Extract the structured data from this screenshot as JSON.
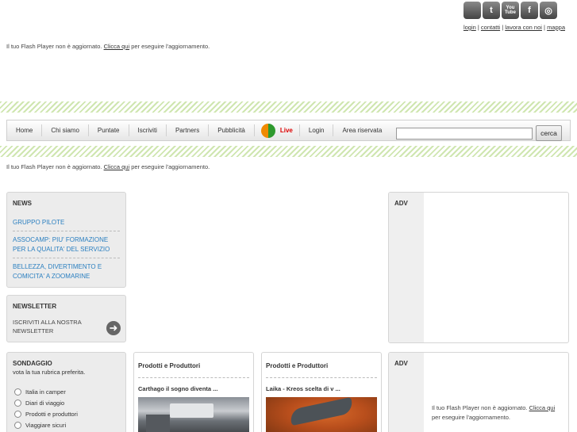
{
  "social": [
    {
      "icon": "apple-icon",
      "glyph": ""
    },
    {
      "icon": "twitter-icon",
      "glyph": "t"
    },
    {
      "icon": "youtube-icon",
      "glyph": "You Tube"
    },
    {
      "icon": "facebook-icon",
      "glyph": "f"
    },
    {
      "icon": "target-icon",
      "glyph": "◎"
    }
  ],
  "toplinks": {
    "login": "login",
    "contatti": "contatti",
    "lavora": "lavora con noi",
    "mappa": "mappa",
    "sep": " | "
  },
  "flash_msg": {
    "prefix": "Il tuo Flash Player non è aggiornato.",
    "link": "Clicca qui",
    "suffix": "per eseguire l'aggiornamento."
  },
  "flash_msg_split": {
    "line1": "Il tuo Flash Player non è aggiornato.",
    "link": "Clicca qui",
    "line2": "per eseguire l'aggiornamento."
  },
  "nav": {
    "items": [
      "Home",
      "Chi siamo",
      "Puntate",
      "Iscriviti",
      "Partners",
      "Pubblicità"
    ],
    "live": "Live",
    "login": "Login",
    "reserved": "Area riservata",
    "search_value": "",
    "search_button": "cerca"
  },
  "news": {
    "title": "NEWS",
    "items": [
      "GRUPPO PILOTE",
      "ASSOCAMP: PIU' FORMAZIONE PER LA QUALITA' DEL SERVIZIO",
      "BELLEZZA, DIVERTIMENTO E COMICITA' A ZOOMARINE"
    ]
  },
  "newsletter": {
    "title": "NEWSLETTER",
    "text": "ISCRIVITI ALLA NOSTRA NEWSLETTER"
  },
  "poll": {
    "title": "SONDAGGIO",
    "subtitle": "vota la tua rubrica preferita.",
    "options": [
      "Italia in camper",
      "Diari di viaggio",
      "Prodotti e produttori",
      "Viaggiare sicuri"
    ]
  },
  "cards": [
    {
      "title": "Prodotti e Produttori",
      "subtitle": "Carthago il sogno diventa ..."
    },
    {
      "title": "Prodotti e Produttori",
      "subtitle": "Laika - Kreos scelta di v ..."
    }
  ],
  "adv": {
    "label": "ADV"
  },
  "colors": {
    "news_link": "#2a7fc0",
    "live_red": "#dd0000",
    "stripe_green": "#cfe6b0"
  }
}
